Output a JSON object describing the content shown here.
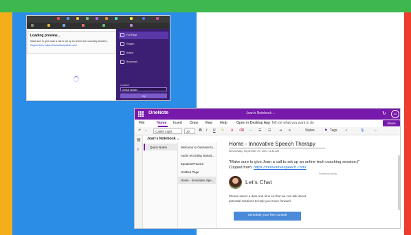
{
  "colors": {
    "top_strip": "#3eb84e",
    "left_strip": "#f3ae1a",
    "right_strip": "#ee3d2e",
    "blue_block": "#2b8de6",
    "onenote_purple": "#7719aa",
    "clipper_purple": "#3c1f72",
    "cta_blue": "#4a8ad8",
    "link_blue": "#1a6bd4"
  },
  "clipper": {
    "dialog_title": "Loading preview...",
    "dialog_line1": "Make sure to give Joan a call to set up an online tech coaching session:)",
    "dialog_line2": "Clipped from: https://innovativespeech.com/",
    "options": [
      {
        "label": "Full Page",
        "icon": "page-icon"
      },
      {
        "label": "Region",
        "icon": "region-icon"
      },
      {
        "label": "Article",
        "icon": "article-icon"
      },
      {
        "label": "Bookmark",
        "icon": "bookmark-icon"
      }
    ],
    "location_label": "Location",
    "location_value": "Default location",
    "clip_button": "Clip"
  },
  "onenote": {
    "app_name": "OneNote",
    "notebook_title": "Joan's Notebook ⌄",
    "menu": [
      "File",
      "Home",
      "Insert",
      "Draw",
      "View",
      "Help"
    ],
    "open_desktop": "Open in Desktop App",
    "tell_me": "Tell me what you want to do",
    "share": "Share",
    "font_name": "Calibri Light",
    "font_size": "20",
    "styles": "Styles",
    "tags": "Tags",
    "notebook_header": "Joan's Notebook ⌄",
    "section": "Quick Notes",
    "pages": [
      "Welcome to OneNote fo...",
      "Audio recording started...",
      "EquationPractice",
      "Untitled Page",
      "Home - Innovative Spe..."
    ],
    "page_title": "Home - Innovative Speech Therapy",
    "page_date": "Wednesday, September 29, 2021    11:48 AM",
    "note_text": "\"Make sure to give Joan a call to set up an online tech coaching session:)\"",
    "clipped_prefix": "Clipped from: ",
    "clipped_link": "https://innovativespeech.com/",
    "powered_by": "Powered by acuity",
    "lets_chat": "Let's Chat",
    "body_text": "Please select a date and time so that we can talk about potential solutions to help you move forward.",
    "cta": "Schedule your free consult"
  }
}
